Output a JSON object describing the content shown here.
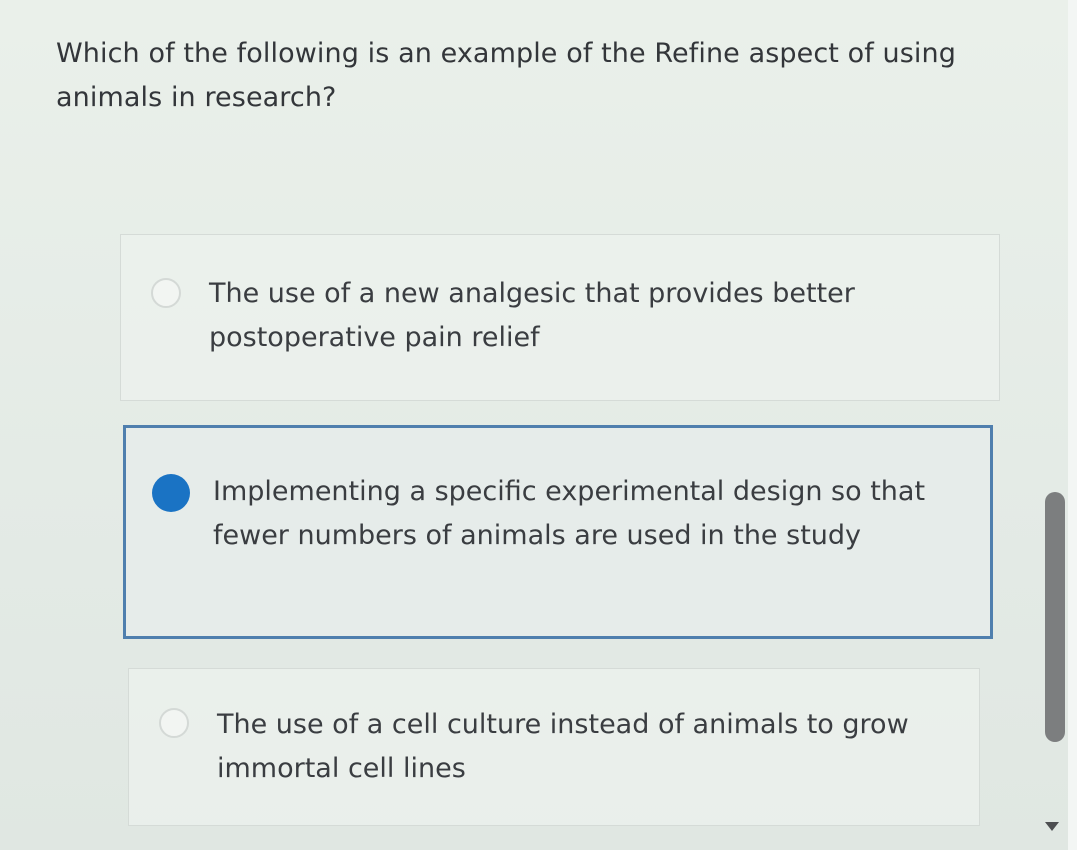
{
  "question": {
    "text": "Which of the following is an example of the Refine aspect of using animals in research?"
  },
  "options": [
    {
      "text": "The use of a new analgesic that provides better postoperative pain relief",
      "selected": false
    },
    {
      "text": "Implementing a specific experimental design so that fewer numbers of animals are used in the study",
      "selected": true
    },
    {
      "text": "The use of a cell culture instead of animals to grow immortal cell lines",
      "selected": false
    }
  ],
  "colors": {
    "accent": "#1a73c4",
    "selected_border": "#4f7fae",
    "scrollbar": "#7c7e7f"
  },
  "icons": {
    "radio_unselected": "radio-empty-icon",
    "radio_selected": "radio-filled-icon",
    "scroll_down": "triangle-down-icon"
  }
}
